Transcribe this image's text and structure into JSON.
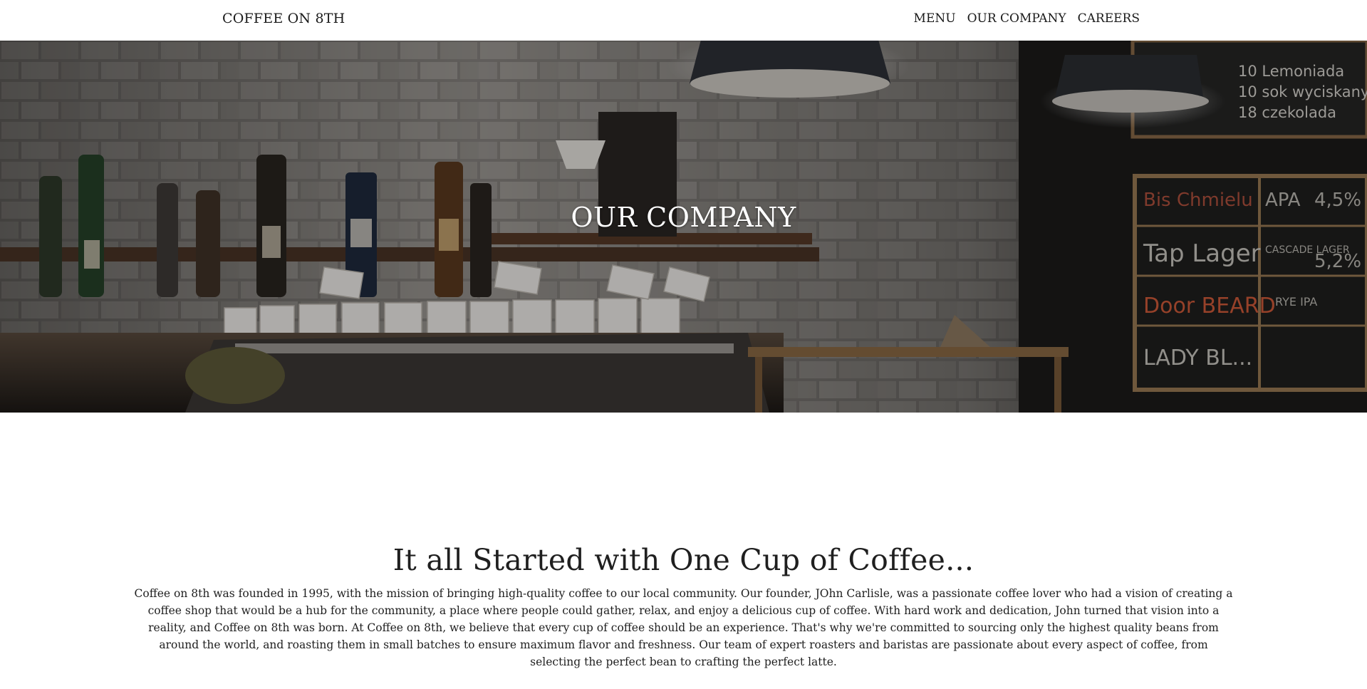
{
  "navbar": {
    "brand": "COFFEE ON 8TH",
    "links": [
      {
        "label": "MENU"
      },
      {
        "label": "OUR COMPANY"
      },
      {
        "label": "CAREERS"
      }
    ]
  },
  "hero": {
    "title": "OUR COMPANY",
    "chalkboard_top": [
      "10 Lemoniada",
      "10 sok wyciskany",
      "18 czekolada"
    ],
    "chalkboard_menu": [
      "Bis Chmielu",
      "APA",
      "4,5%",
      "Tap Lager",
      "CASCADE LAGER",
      "5,2%",
      "Door BEARD",
      "RYE IPA",
      "LADY BL..."
    ]
  },
  "story": {
    "heading": "It all Started with One Cup of Coffee...",
    "body": "Coffee on 8th was founded in 1995, with the mission of bringing high-quality coffee to our local community. Our founder, JOhn Carlisle, was a passionate coffee lover who had a vision of creating a coffee shop that would be a hub for the community, a place where people could gather, relax, and enjoy a delicious cup of coffee. With hard work and dedication, John turned that vision into a reality, and Coffee on 8th was born. At Coffee on 8th, we believe that every cup of coffee should be an experience. That's why we're committed to sourcing only the highest quality beans from around the world, and roasting them in small batches to ensure maximum flavor and freshness. Our team of expert roasters and baristas are passionate about every aspect of coffee, from selecting the perfect bean to crafting the perfect latte."
  }
}
